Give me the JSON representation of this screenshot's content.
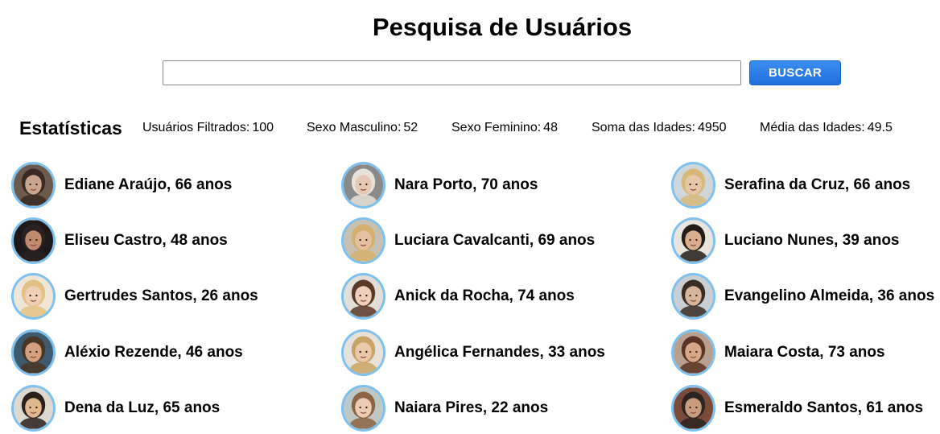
{
  "page": {
    "title": "Pesquisa de Usuários"
  },
  "search": {
    "value": "",
    "placeholder": "",
    "button_label": "BUSCAR"
  },
  "stats": {
    "heading": "Estatísticas",
    "items": [
      {
        "label": "Usuários Filtrados:",
        "value": "100"
      },
      {
        "label": "Sexo Masculino:",
        "value": "52"
      },
      {
        "label": "Sexo Feminino:",
        "value": "48"
      },
      {
        "label": "Soma das Idades:",
        "value": "4950"
      },
      {
        "label": "Média das Idades:",
        "value": "49.5"
      }
    ]
  },
  "colors": {
    "avatar_border": "#7ec0ee",
    "button": "#2a7be8"
  },
  "users": [
    {
      "name": "Ediane Araújo, 66 anos",
      "skin": "#c9a58c",
      "hair": "#3a2a22",
      "bg": "#6b5a4e"
    },
    {
      "name": "Nara Porto, 70 anos",
      "skin": "#e6c9b4",
      "hair": "#e8e2d8",
      "bg": "#8a8a88"
    },
    {
      "name": "Serafina da Cruz, 66 anos",
      "skin": "#e8c6a8",
      "hair": "#d8b878",
      "bg": "#cfd6da"
    },
    {
      "name": "Eliseu Castro, 48 anos",
      "skin": "#c08a6e",
      "hair": "#2a2220",
      "bg": "#1e1a1a"
    },
    {
      "name": "Luciara Cavalcanti, 69 anos",
      "skin": "#e4bfa0",
      "hair": "#d6b070",
      "bg": "#c8c0b0"
    },
    {
      "name": "Luciano Nunes, 39 anos",
      "skin": "#d8ae8e",
      "hair": "#231c18",
      "bg": "#e8e4de"
    },
    {
      "name": "Gertrudes Santos, 26 anos",
      "skin": "#efcfb6",
      "hair": "#e2c284",
      "bg": "#efe6d8"
    },
    {
      "name": "Anick da Rocha, 74 anos",
      "skin": "#ecd0bc",
      "hair": "#5a3a28",
      "bg": "#e2ddd6"
    },
    {
      "name": "Evangelino Almeida, 36 anos",
      "skin": "#d8b49a",
      "hair": "#3a2c24",
      "bg": "#c9ced2"
    },
    {
      "name": "Aléxio Rezende, 46 anos",
      "skin": "#d2a080",
      "hair": "#4a3626",
      "bg": "#3e5a6e"
    },
    {
      "name": "Angélica Fernandes, 33 anos",
      "skin": "#ecc8aa",
      "hair": "#caa464",
      "bg": "#e6e2da"
    },
    {
      "name": "Maiara Costa, 73 anos",
      "skin": "#d6a888",
      "hair": "#5a3424",
      "bg": "#b8a090"
    },
    {
      "name": "Dena da Luz, 65 anos",
      "skin": "#e0b890",
      "hair": "#2a201c",
      "bg": "#ddd8d0"
    },
    {
      "name": "Naiara Pires, 22 anos",
      "skin": "#ecccb4",
      "hair": "#8a6444",
      "bg": "#bfc8c4"
    },
    {
      "name": "Esmeraldo Santos, 61 anos",
      "skin": "#c89c80",
      "hair": "#2c2420",
      "bg": "#7a4a3a"
    }
  ]
}
